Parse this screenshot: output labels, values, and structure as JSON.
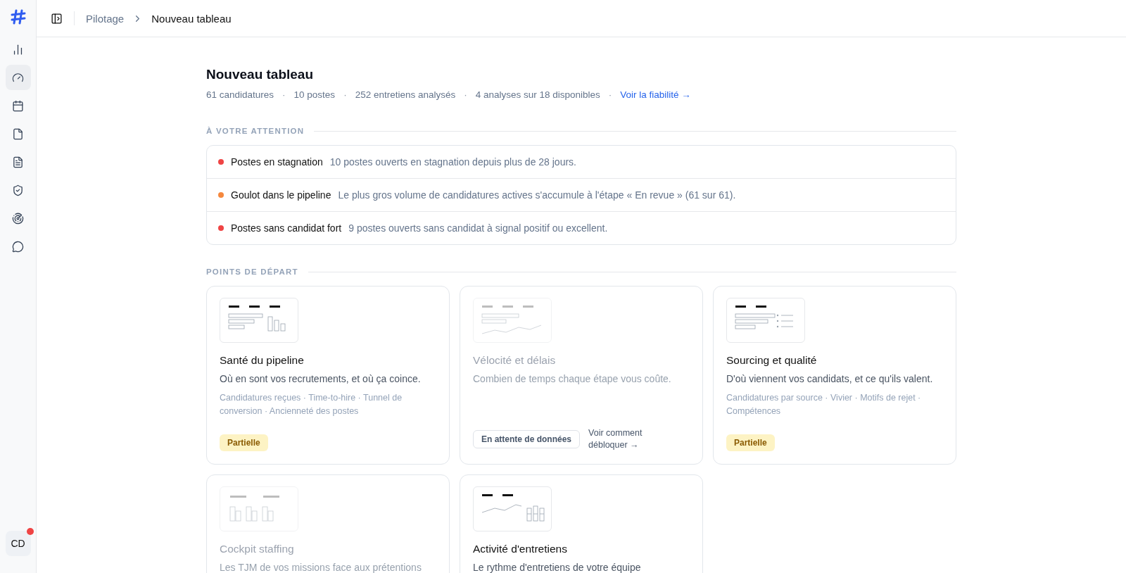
{
  "sidebar": {
    "items": [
      {
        "kind": "chart",
        "selected": false
      },
      {
        "kind": "gauge",
        "selected": true
      },
      {
        "kind": "calendar",
        "selected": false
      },
      {
        "kind": "file",
        "selected": false
      },
      {
        "kind": "document",
        "selected": false
      },
      {
        "kind": "shield",
        "selected": false
      },
      {
        "kind": "radar",
        "selected": false
      },
      {
        "kind": "chat",
        "selected": false
      }
    ],
    "avatar": {
      "initials": "CD",
      "notification": true
    }
  },
  "breadcrumb": [
    "Pilotage",
    "Nouveau tableau"
  ],
  "page": {
    "title": "Nouveau tableau",
    "stats": [
      "61 candidatures",
      "10 postes",
      "252 entretiens analysés",
      "4 analyses sur 18 disponibles"
    ],
    "separator": "·",
    "link": "Voir la fiabilité →"
  },
  "attention": {
    "heading": "À VOTRE ATTENTION",
    "items": [
      {
        "color": "#ef4444",
        "title": "Postes en stagnation",
        "text": "10 postes ouverts en stagnation depuis plus de 28 jours."
      },
      {
        "color": "#f5883e",
        "title": "Goulot dans le pipeline",
        "text": "Le plus gros volume de candidatures actives s'accumule à l'étape « En revue » (61 sur 61)."
      },
      {
        "color": "#ef4444",
        "title": "Postes sans candidat fort",
        "text": "9 postes ouverts sans candidat à signal positif ou excellent."
      }
    ]
  },
  "starting_points": {
    "heading": "POINTS DE DÉPART",
    "cards": [
      {
        "kind": "bars",
        "disabled": false,
        "title": "Santé du pipeline",
        "description": "Où en sont vos recrutements, et où ça coince.",
        "metrics": "Candidatures reçues · Time-to-hire · Tunnel de conversion · Ancienneté des postes",
        "badge": "Partielle"
      },
      {
        "kind": "line",
        "disabled": true,
        "title": "Vélocité et délais",
        "description": "Combien de temps chaque étape vous coûte.",
        "status": "En attente de données",
        "link": "Voir comment débloquer →"
      },
      {
        "kind": "list",
        "disabled": false,
        "title": "Sourcing et qualité",
        "description": "D'où viennent vos candidats, et ce qu'ils valent.",
        "metrics": "Candidatures par source · Vivier · Motifs de rejet · Compétences",
        "badge": "Partielle"
      },
      {
        "kind": "staffing",
        "disabled": true,
        "title": "Cockpit staffing",
        "description": "Les TJM de vos missions face aux prétentions"
      },
      {
        "kind": "activity",
        "disabled": false,
        "title": "Activité d'entretiens",
        "description": "Le rythme d'entretiens de votre équipe"
      }
    ]
  }
}
